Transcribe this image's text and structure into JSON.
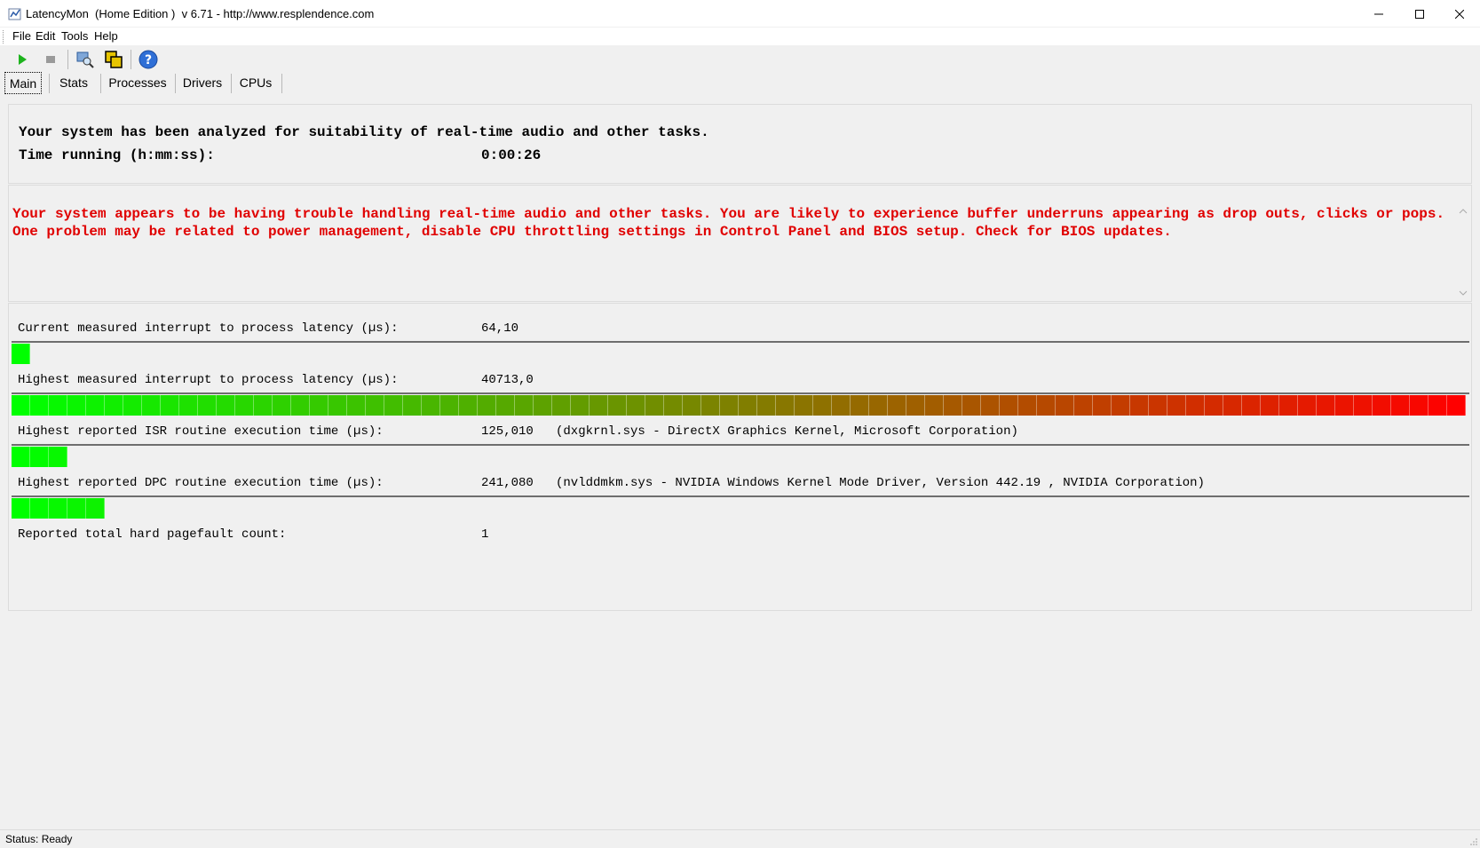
{
  "window": {
    "title": "LatencyMon  (Home Edition )  v 6.71 - http://www.resplendence.com"
  },
  "menu": {
    "items": [
      "File",
      "Edit",
      "Tools",
      "Help"
    ]
  },
  "toolbar": {
    "buttons": [
      "play-icon",
      "stop-icon",
      "driver-search-icon",
      "copy-icon",
      "help-icon"
    ]
  },
  "tabs": {
    "items": [
      "Main",
      "Stats",
      "Processes",
      "Drivers",
      "CPUs"
    ],
    "active": "Main"
  },
  "summary": {
    "line1": "Your system has been analyzed for suitability of real-time audio and other tasks.",
    "time_label": "Time running (h:mm:ss):",
    "time_value": "0:00:26"
  },
  "alert": {
    "message": "Your system appears to be having trouble handling real-time audio and other tasks. You are likely to experience buffer underruns appearing as drop outs, clicks or pops. One problem may be related to power management, disable CPU throttling settings in Control Panel and BIOS setup. Check for BIOS updates.",
    "color": "#e00000"
  },
  "metrics": {
    "current": {
      "label": "Current measured interrupt to process latency (µs):",
      "value": "64,10",
      "bar_fraction": 0.012
    },
    "highest": {
      "label": "Highest measured interrupt to process latency (µs):",
      "value": "40713,0",
      "bar_fraction": 1.0
    },
    "isr": {
      "label": "Highest reported ISR routine execution time (µs):",
      "value": "125,010",
      "driver": "(dxgkrnl.sys - DirectX Graphics Kernel, Microsoft Corporation)",
      "bar_fraction": 0.04
    },
    "dpc": {
      "label": "Highest reported DPC routine execution time (µs):",
      "value": "241,080",
      "driver": "(nvlddmkm.sys - NVIDIA Windows Kernel Mode Driver, Version 442.19 , NVIDIA Corporation)",
      "bar_fraction": 0.067
    },
    "pagefault": {
      "label": "Reported total hard pagefault count:",
      "value": "1"
    }
  },
  "colors": {
    "bar_start": "#00ff00",
    "bar_end": "#ff0000"
  },
  "status": {
    "text": "Status: Ready"
  }
}
